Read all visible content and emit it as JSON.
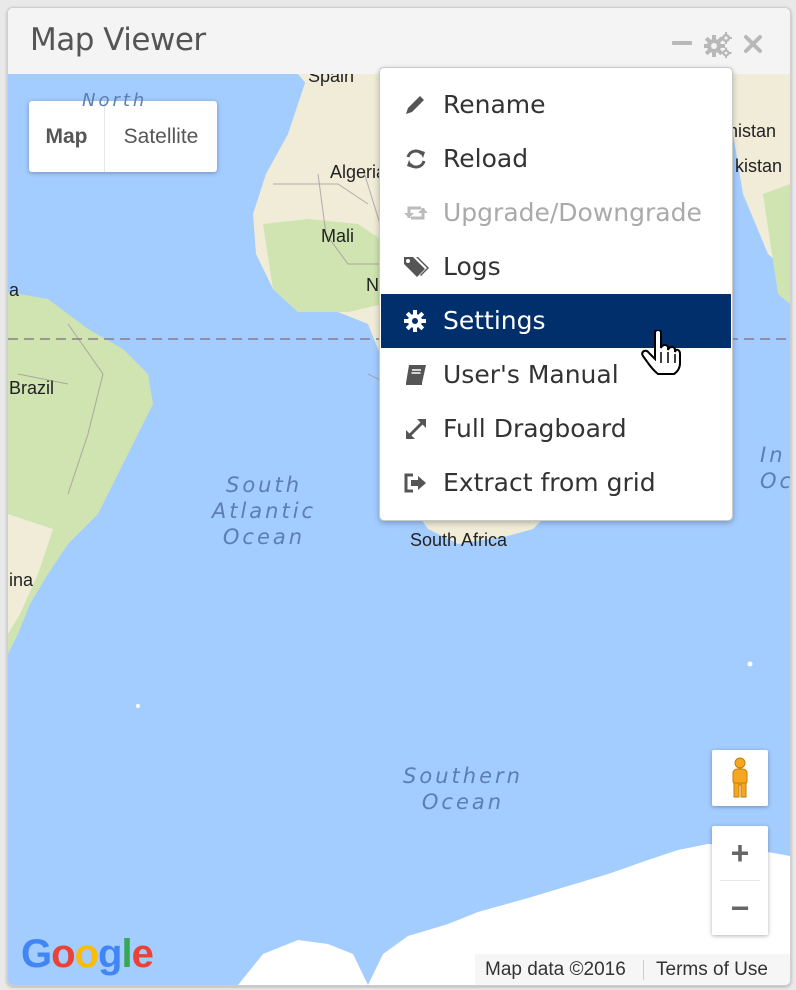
{
  "window": {
    "title": "Map Viewer",
    "controls": [
      "minimize-icon",
      "gear-icon",
      "close-icon"
    ]
  },
  "map": {
    "type_control": {
      "map_label": "Map",
      "satellite_label": "Satellite",
      "selected": "Map"
    },
    "labels": {
      "north": "North",
      "spain": "Spain",
      "algeria": "Algeria",
      "mali": "Mali",
      "n_partial": "N",
      "brazil": "Brazil",
      "ina_partial": "ina",
      "a_partial": "a",
      "south_africa": "South Africa",
      "kistan_partial": "kistan",
      "nistan_partial": "nistan",
      "in_partial": "In",
      "oc_partial": "Oc"
    },
    "oceans": {
      "south_atlantic_1": "South",
      "south_atlantic_2": "Atlantic",
      "south_atlantic_3": "Ocean",
      "southern_1": "Southern",
      "southern_2": "Ocean"
    },
    "zoom_in": "+",
    "zoom_out": "−",
    "logo": "Google",
    "attribution": "Map data ©2016",
    "terms": "Terms of Use"
  },
  "menu": {
    "items": [
      {
        "label": "Rename",
        "icon": "pencil-icon",
        "state": "normal"
      },
      {
        "label": "Reload",
        "icon": "refresh-icon",
        "state": "normal"
      },
      {
        "label": "Upgrade/Downgrade",
        "icon": "retweet-icon",
        "state": "disabled"
      },
      {
        "label": "Logs",
        "icon": "tags-icon",
        "state": "normal"
      },
      {
        "label": "Settings",
        "icon": "gear-icon",
        "state": "active"
      },
      {
        "label": "User's Manual",
        "icon": "book-icon",
        "state": "normal"
      },
      {
        "label": "Full Dragboard",
        "icon": "expand-icon",
        "state": "normal"
      },
      {
        "label": "Extract from grid",
        "icon": "sign-out-icon",
        "state": "normal"
      }
    ]
  },
  "colors": {
    "ocean": "#a3ccff",
    "land": "#f0ecd8",
    "vegetation": "#cfe4b0",
    "menu_active": "#002f6c"
  }
}
